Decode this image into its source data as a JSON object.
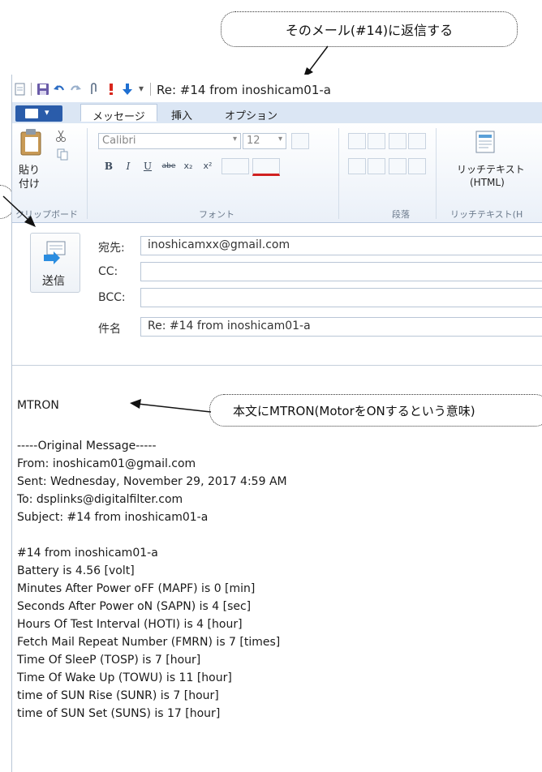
{
  "callouts": {
    "reply": "そのメール(#14)に返信する",
    "body": "本文にMTRON(MotorをONするという意味)"
  },
  "window": {
    "title": "Re: #14 from inoshicam01-a"
  },
  "tabs": [
    {
      "label": "メッセージ"
    },
    {
      "label": "挿入"
    },
    {
      "label": "オプション"
    }
  ],
  "ribbon": {
    "paste": "貼り\n付け",
    "paste_line1": "貼り",
    "paste_line2": "付け",
    "font_name": "Calibri",
    "font_size": "12",
    "rich_text_line1": "リッチテキスト",
    "rich_text_line2": "(HTML)",
    "groups": {
      "clipboard": "クリップボード",
      "font": "フォント",
      "paragraph": "段落",
      "richtext": "リッチテキスト(H"
    }
  },
  "compose": {
    "send": "送信",
    "to_label": "宛先:",
    "to_value": "inoshicamxx@gmail.com",
    "cc_label": "CC:",
    "cc_value": "",
    "bcc_label": "BCC:",
    "bcc_value": "",
    "subject_label": "件名",
    "subject_value": "Re: #14 from inoshicam01-a"
  },
  "body": {
    "reply_text": "MTRON",
    "original_header": "-----Original Message-----",
    "from": "From: inoshicam01@gmail.com",
    "sent": "Sent: Wednesday, November 29, 2017 4:59 AM",
    "to": "To: dsplinks@digitalfilter.com",
    "subject": "Subject: #14 from inoshicam01-a",
    "lines": [
      "#14 from inoshicam01-a",
      "Battery is 4.56 [volt]",
      "Minutes After Power oFF (MAPF) is 0 [min]",
      "Seconds After Power oN (SAPN) is 4 [sec]",
      "Hours Of Test Interval (HOTI) is 4 [hour]",
      "Fetch Mail Repeat Number (FMRN) is 7 [times]",
      "Time Of SleeP (TOSP) is 7 [hour]",
      "Time Of Wake Up (TOWU) is 11 [hour]",
      "time of SUN Rise (SUNR) is 7 [hour]",
      "time of SUN Set (SUNS) is 17 [hour]"
    ]
  },
  "colors": {
    "file_button": "#2a5caa",
    "tab_bar": "#dbe6f4",
    "ribbon_border": "#b7c8df"
  },
  "icons": [
    "new-icon",
    "save-icon",
    "undo-icon",
    "redo-icon",
    "attach-icon",
    "high-priority-icon",
    "low-priority-icon",
    "qat-dropdown-icon",
    "paste-icon",
    "cut-icon",
    "copy-icon",
    "send-icon",
    "rich-text-icon"
  ]
}
